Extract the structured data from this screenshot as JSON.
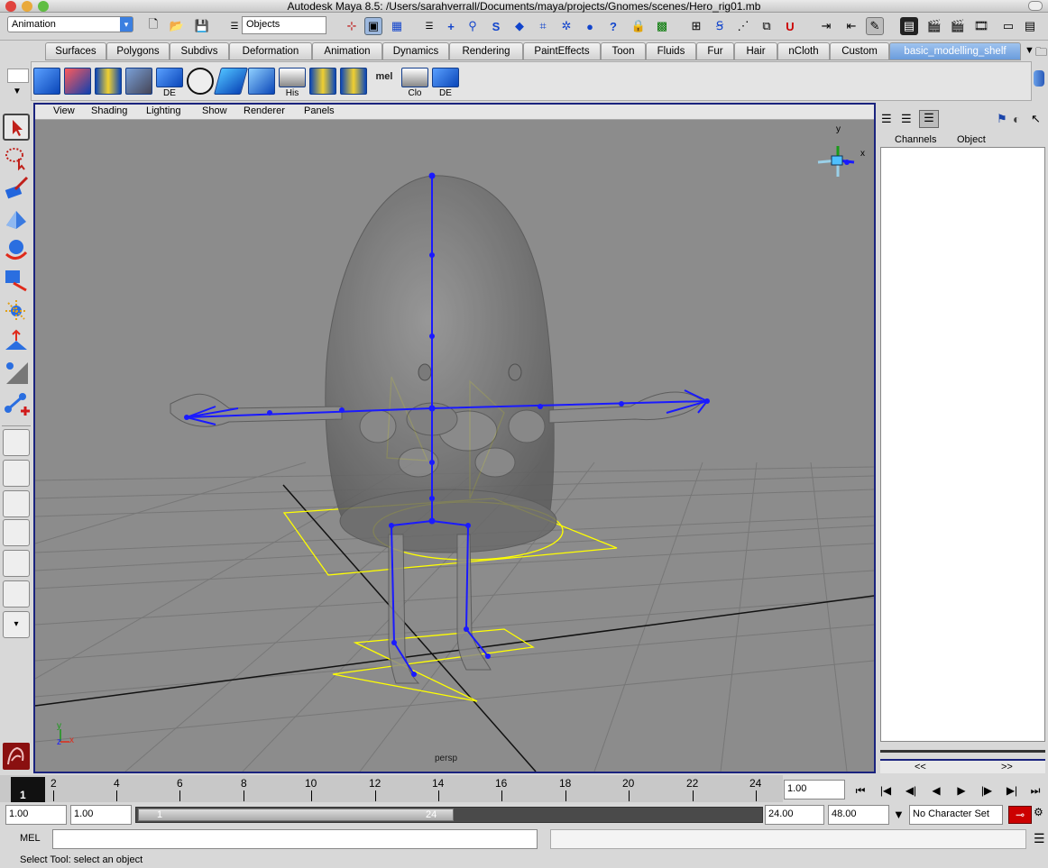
{
  "window": {
    "title": "Autodesk Maya 8.5: /Users/sarahverrall/Documents/maya/projects/Gnomes/scenes/Hero_rig01.mb"
  },
  "status_line": {
    "menu_set": "Animation",
    "selection_mode": "Objects"
  },
  "shelf_tabs": [
    "Surfaces",
    "Polygons",
    "Subdivs",
    "Deformation",
    "Animation",
    "Dynamics",
    "Rendering",
    "PaintEffects",
    "Toon",
    "Fluids",
    "Fur",
    "Hair",
    "nCloth",
    "Custom",
    "basic_modelling_shelf"
  ],
  "active_shelf": "basic_modelling_shelf",
  "shelf_labels": {
    "de1": "DE",
    "his": "His",
    "mel": "mel",
    "clo": "Clo",
    "de2": "DE"
  },
  "viewport": {
    "menus": [
      "View",
      "Shading",
      "Lighting",
      "Show",
      "Renderer",
      "Panels"
    ],
    "camera": "persp",
    "axis_labels": {
      "y": "y",
      "z": "z",
      "x": "x"
    }
  },
  "channel_box": {
    "tabs": [
      "Channels",
      "Object"
    ],
    "nav_left": "<<",
    "nav_right": ">>"
  },
  "timeline": {
    "ticks": [
      "2",
      "4",
      "6",
      "8",
      "10",
      "12",
      "14",
      "16",
      "18",
      "20",
      "22",
      "24"
    ],
    "current_frame_marker": "1",
    "current_time": "1.00"
  },
  "range": {
    "start_time": "1.00",
    "playback_start": "1.00",
    "slider_start": "1",
    "slider_end": "24",
    "playback_end": "24.00",
    "end_time": "48.00",
    "character_set": "No Character Set"
  },
  "command_line": {
    "label": "MEL"
  },
  "help_line": "Select Tool: select an object",
  "colors": {
    "viewport_bg": "#8c8c8c",
    "joint": "#1a1aff",
    "control": "#ffff00",
    "active_tab": "#6a9cdc"
  }
}
